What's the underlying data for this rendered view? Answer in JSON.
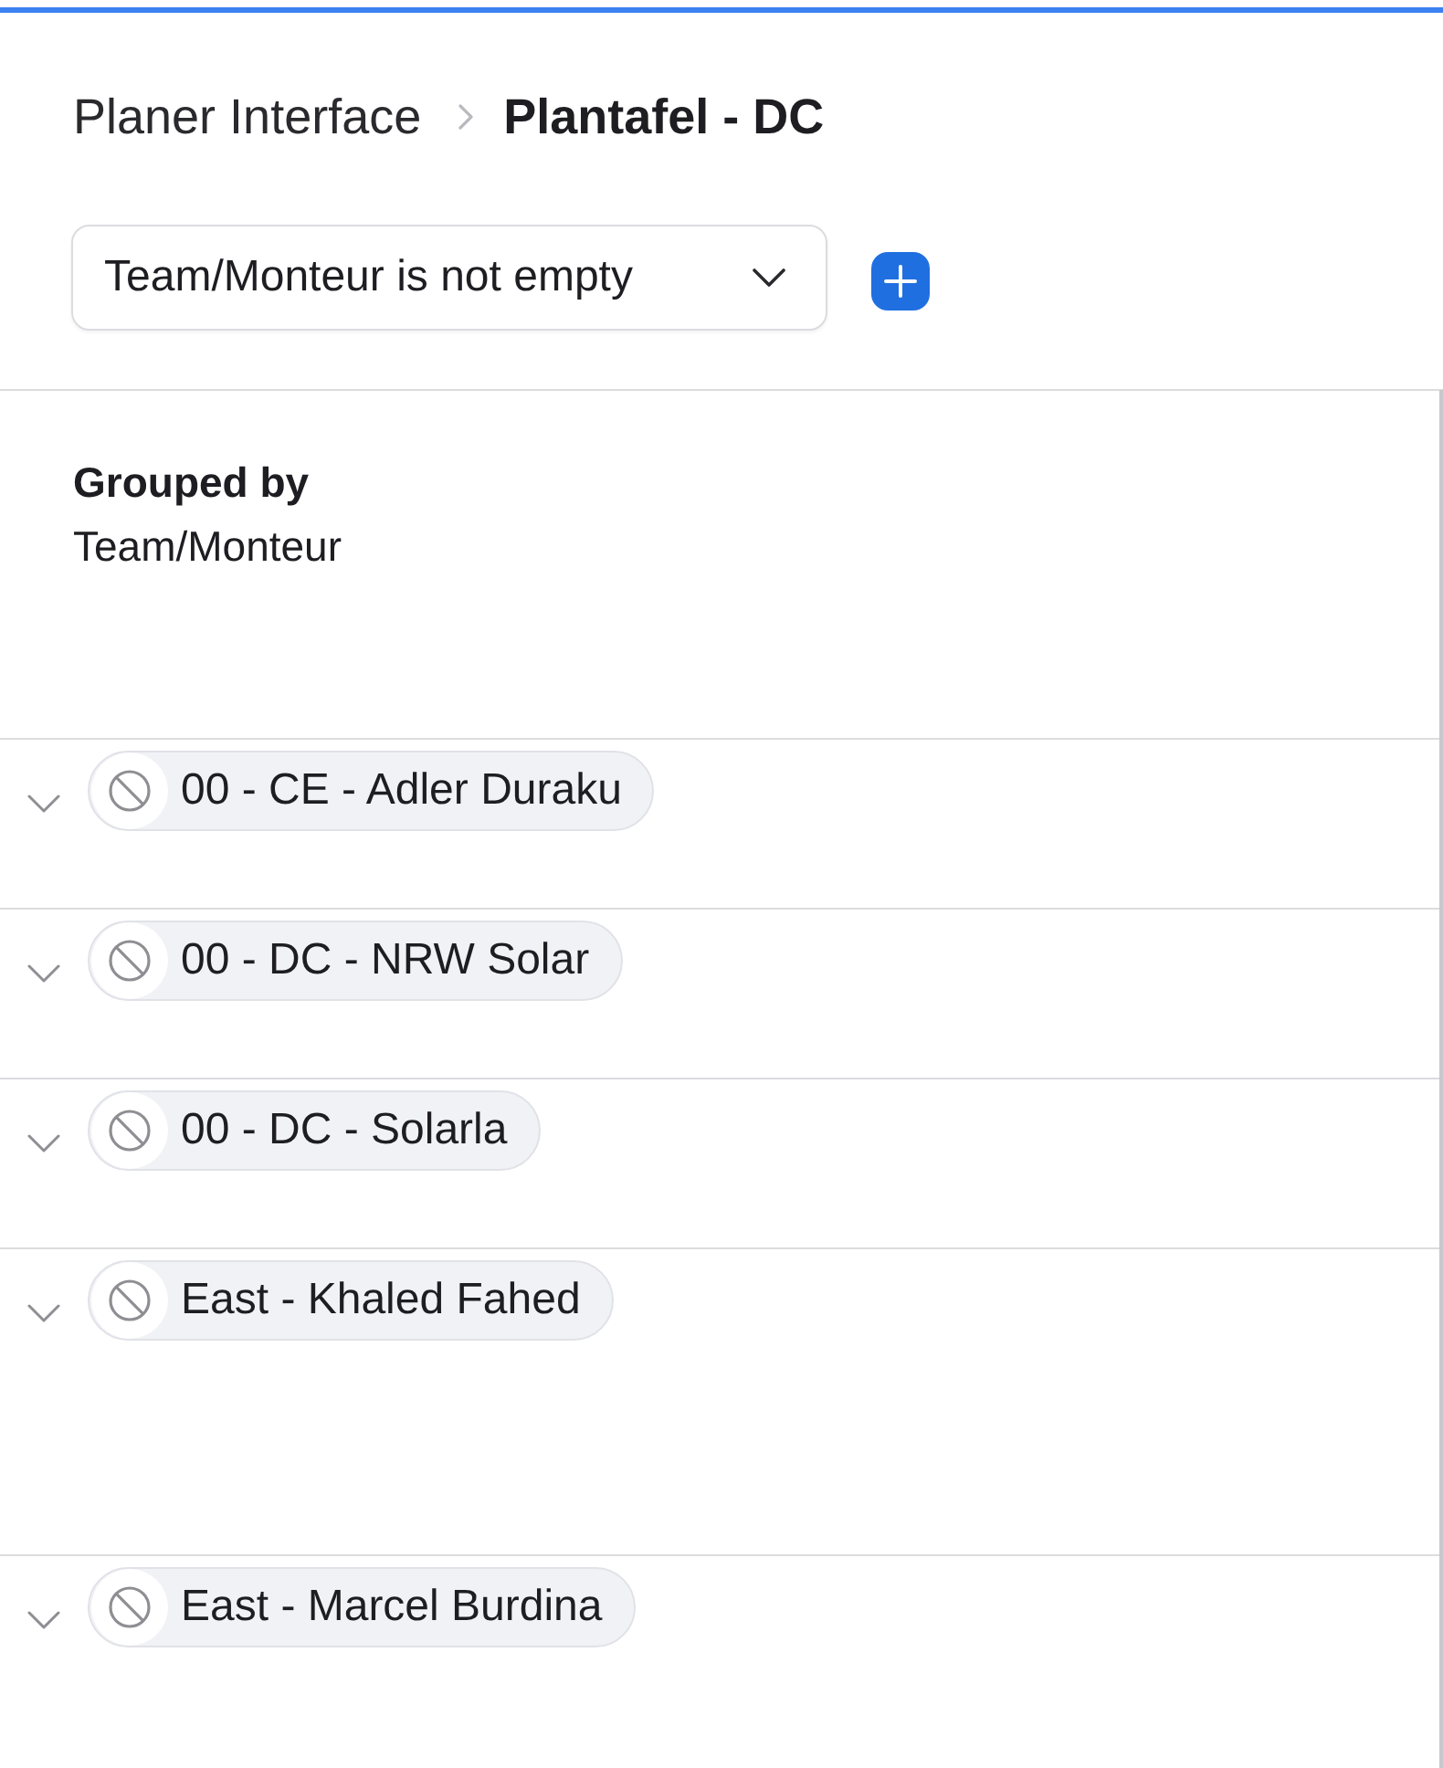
{
  "breadcrumb": {
    "parent": "Planer Interface",
    "current": "Plantafel - DC"
  },
  "filter": {
    "label": "Team/Monteur is not empty"
  },
  "grouping": {
    "label": "Grouped by",
    "field": "Team/Monteur"
  },
  "groups": [
    {
      "name": "00 - CE - Adler Duraku"
    },
    {
      "name": "00 - DC - NRW Solar"
    },
    {
      "name": "00 - DC - Solarla"
    },
    {
      "name": "East - Khaled Fahed"
    },
    {
      "name": "East - Marcel Burdina"
    }
  ]
}
